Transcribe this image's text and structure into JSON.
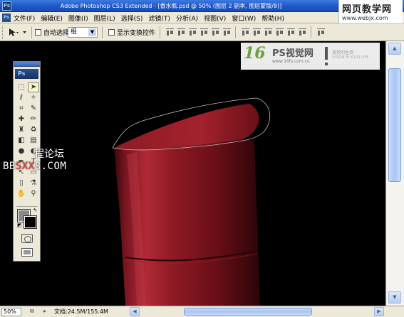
{
  "window": {
    "title": "Adobe Photoshop CS3 Extended - [香水瓶.psd @ 50% (图层 2 副本, 图层蒙版/8)]",
    "app_icon": "Ps"
  },
  "watermark_top": {
    "title": "网页教学网",
    "url": "www.webjx.com"
  },
  "menu": {
    "items": [
      "文件(F)",
      "编辑(E)",
      "图像(I)",
      "图层(L)",
      "选择(S)",
      "滤镜(T)",
      "分析(A)",
      "视图(V)",
      "窗口(W)",
      "帮助(H)"
    ]
  },
  "options": {
    "auto_select_label": "自动选择:",
    "auto_select_value": "组",
    "show_transform_label": "显示变换控件",
    "tool_icon": "move-tool-icon"
  },
  "canvas_logo": {
    "number": "16",
    "name": "PS视觉网",
    "url": "www.16fs.com.cn",
    "tagline": "视觉的生活",
    "tagline_en": "VISION IN YOUR LIFE"
  },
  "toolbox": {
    "logo": "Ps",
    "tools": [
      {
        "name": "marquee-tool-icon",
        "glyph": "⬚",
        "active": false
      },
      {
        "name": "move-tool-icon",
        "glyph": "➤",
        "active": true
      },
      {
        "name": "lasso-tool-icon",
        "glyph": "ℓ",
        "active": false
      },
      {
        "name": "magic-wand-icon",
        "glyph": "✧",
        "active": false
      },
      {
        "name": "crop-tool-icon",
        "glyph": "⌗",
        "active": false
      },
      {
        "name": "slice-tool-icon",
        "glyph": "✎",
        "active": false
      },
      {
        "name": "healing-brush-icon",
        "glyph": "✚",
        "active": false
      },
      {
        "name": "brush-tool-icon",
        "glyph": "✏",
        "active": false
      },
      {
        "name": "clone-stamp-icon",
        "glyph": "♜",
        "active": false
      },
      {
        "name": "history-brush-icon",
        "glyph": "♻",
        "active": false
      },
      {
        "name": "eraser-tool-icon",
        "glyph": "◧",
        "active": false
      },
      {
        "name": "gradient-tool-icon",
        "glyph": "▤",
        "active": false
      },
      {
        "name": "blur-tool-icon",
        "glyph": "●",
        "active": false
      },
      {
        "name": "dodge-tool-icon",
        "glyph": "◐",
        "active": false
      },
      {
        "name": "pen-tool-icon",
        "glyph": "✒",
        "active": false
      },
      {
        "name": "type-tool-icon",
        "glyph": "T",
        "active": false
      },
      {
        "name": "path-selection-icon",
        "glyph": "↖",
        "active": false
      },
      {
        "name": "shape-tool-icon",
        "glyph": "▭",
        "active": false
      },
      {
        "name": "notes-tool-icon",
        "glyph": "▯",
        "active": false
      },
      {
        "name": "eyedropper-tool-icon",
        "glyph": "⚗",
        "active": false
      },
      {
        "name": "hand-tool-icon",
        "glyph": "✋",
        "active": false
      },
      {
        "name": "zoom-tool-icon",
        "glyph": "⚲",
        "active": false
      }
    ],
    "foreground_color": "#8a8a8a",
    "background_color": "#000000"
  },
  "forum_watermark": {
    "line1": "程论坛",
    "line2_prefix": "BB",
    "line2_mid": "SXX",
    "line2_suffix": "8.COM"
  },
  "status": {
    "zoom": "50%",
    "doc_size": "文档:24.5M/155.4M"
  },
  "colors": {
    "bottle_red": "#8a1620",
    "canvas_bg": "#000000",
    "titlebar": "#1f57c9"
  }
}
